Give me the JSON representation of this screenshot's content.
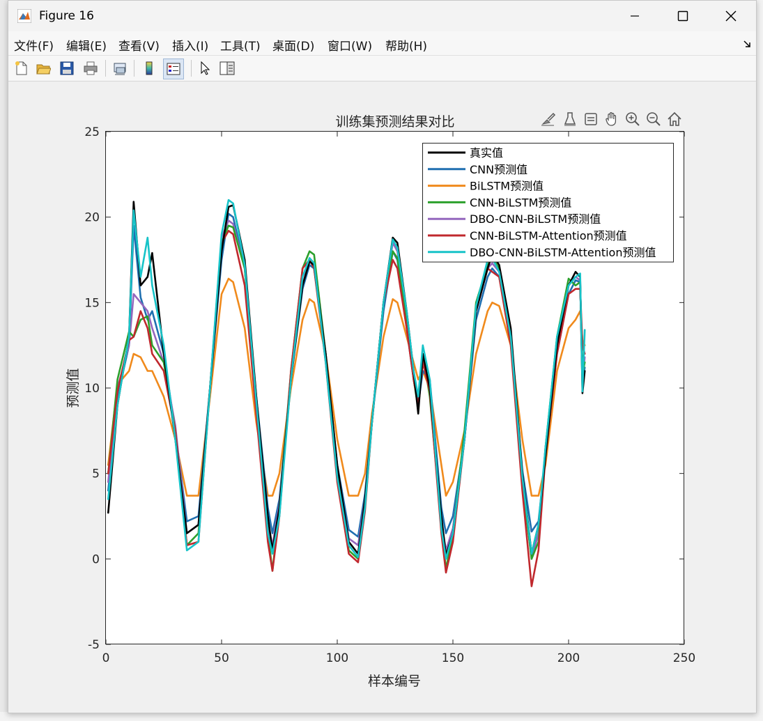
{
  "window": {
    "title": "Figure 16"
  },
  "menu": [
    {
      "label": "文件(F)"
    },
    {
      "label": "编辑(E)"
    },
    {
      "label": "查看(V)"
    },
    {
      "label": "插入(I)"
    },
    {
      "label": "工具(T)"
    },
    {
      "label": "桌面(D)"
    },
    {
      "label": "窗口(W)"
    },
    {
      "label": "帮助(H)"
    }
  ],
  "toolbar": {
    "icons": [
      "new-figure-icon",
      "open-file-icon",
      "save-icon",
      "print-icon",
      "link-plot-icon",
      "insert-colorbar-icon",
      "insert-legend-icon",
      "edit-plot-arrow-icon",
      "property-inspector-icon"
    ]
  },
  "axes_toolbar": {
    "icons": [
      "brush-icon",
      "data-tips-icon",
      "data-cursor-icon",
      "pan-icon",
      "zoom-in-icon",
      "zoom-out-icon",
      "home-icon"
    ]
  },
  "colors": {
    "真实值": "#000000",
    "CNN预测值": "#1f6fb0",
    "BiLSTM预测值": "#f08a1c",
    "CNN-BiLSTM预测值": "#2ca02c",
    "DBO-CNN-BiLSTM预测值": "#9467bd",
    "CNN-BiLSTM-Attention预测值": "#c0282d",
    "DBO-CNN-BiLSTM-Attention预测值": "#17c3c8"
  },
  "chart_data": {
    "type": "line",
    "title": "训练集预测结果对比",
    "xlabel": "样本编号",
    "ylabel": "预测值",
    "xlim": [
      0,
      250
    ],
    "ylim": [
      -5,
      25
    ],
    "xticks": [
      0,
      50,
      100,
      150,
      200,
      250
    ],
    "yticks": [
      -5,
      0,
      5,
      10,
      15,
      20,
      25
    ],
    "legend_position": "top-right",
    "x": [
      1,
      5,
      10,
      12,
      15,
      18,
      20,
      25,
      30,
      35,
      40,
      45,
      50,
      53,
      55,
      60,
      65,
      70,
      72,
      75,
      80,
      85,
      88,
      90,
      95,
      100,
      105,
      109,
      112,
      115,
      120,
      124,
      126,
      130,
      133,
      135,
      137,
      140,
      145,
      147,
      150,
      155,
      160,
      165,
      167,
      170,
      175,
      180,
      184,
      187,
      190,
      195,
      200,
      203,
      205,
      206,
      207
    ],
    "series": [
      {
        "name": "真实值",
        "values": [
          2.7,
          9.0,
          13.0,
          20.9,
          16.0,
          16.5,
          17.9,
          12.0,
          7.0,
          1.5,
          2.0,
          10.0,
          18.0,
          20.6,
          20.7,
          17.5,
          9.5,
          2.5,
          0.5,
          3.0,
          10.5,
          16.0,
          17.4,
          17.2,
          12.0,
          5.5,
          1.0,
          0.3,
          3.5,
          8.0,
          15.0,
          18.8,
          18.5,
          14.5,
          11.0,
          8.5,
          12.0,
          10.0,
          2.5,
          0.2,
          1.5,
          7.0,
          14.5,
          17.0,
          17.8,
          17.2,
          13.5,
          5.0,
          0.3,
          2.0,
          6.0,
          12.5,
          16.0,
          16.8,
          16.5,
          9.7,
          11.0
        ]
      },
      {
        "name": "CNN预测值",
        "values": [
          4.0,
          9.5,
          12.5,
          19.5,
          15.3,
          14.0,
          14.5,
          12.0,
          7.5,
          2.2,
          2.5,
          10.0,
          17.5,
          20.2,
          20.0,
          17.0,
          9.5,
          3.0,
          1.5,
          3.5,
          10.5,
          15.8,
          17.2,
          17.0,
          12.0,
          5.5,
          1.7,
          1.3,
          3.8,
          8.0,
          14.5,
          18.0,
          17.5,
          13.5,
          10.5,
          9.0,
          11.0,
          10.5,
          3.0,
          1.5,
          2.5,
          7.0,
          14.0,
          16.5,
          17.0,
          16.5,
          13.0,
          5.2,
          1.6,
          2.2,
          6.0,
          12.0,
          15.5,
          16.3,
          16.2,
          10.5,
          11.2
        ]
      },
      {
        "name": "BiLSTM预测值",
        "values": [
          5.5,
          10.2,
          11.0,
          12.0,
          11.8,
          11.0,
          11.0,
          9.5,
          7.0,
          3.7,
          3.7,
          9.5,
          15.5,
          16.4,
          16.2,
          13.5,
          8.0,
          3.7,
          3.7,
          5.0,
          10.0,
          14.0,
          15.2,
          15.0,
          12.0,
          7.0,
          3.7,
          3.7,
          5.0,
          8.5,
          13.0,
          15.2,
          15.0,
          13.0,
          11.5,
          10.5,
          11.0,
          10.0,
          5.5,
          3.7,
          4.5,
          7.5,
          12.0,
          14.5,
          15.0,
          14.8,
          12.5,
          7.0,
          3.7,
          3.7,
          5.5,
          11.0,
          13.5,
          14.0,
          14.5,
          12.8,
          12.5
        ]
      },
      {
        "name": "CNN-BiLSTM预测值",
        "values": [
          5.0,
          10.5,
          13.3,
          13.0,
          14.0,
          14.2,
          12.5,
          11.5,
          7.5,
          0.8,
          1.5,
          10.0,
          18.5,
          19.5,
          19.4,
          17.0,
          9.0,
          1.5,
          -0.7,
          3.0,
          11.0,
          17.0,
          18.0,
          17.8,
          12.0,
          5.0,
          0.5,
          0.0,
          3.0,
          8.0,
          15.0,
          18.0,
          17.6,
          14.0,
          10.5,
          8.8,
          12.0,
          9.5,
          2.0,
          -0.6,
          1.5,
          7.5,
          15.0,
          17.2,
          17.6,
          17.0,
          12.8,
          4.5,
          0.0,
          1.0,
          6.5,
          13.0,
          16.4,
          16.0,
          16.2,
          10.8,
          11.5
        ]
      },
      {
        "name": "DBO-CNN-BiLSTM预测值",
        "values": [
          4.5,
          10.0,
          12.5,
          15.5,
          15.0,
          14.5,
          13.5,
          11.5,
          7.8,
          1.5,
          2.0,
          10.0,
          18.8,
          19.8,
          19.6,
          17.0,
          9.2,
          2.0,
          0.8,
          3.2,
          10.8,
          16.0,
          17.6,
          17.3,
          12.0,
          5.0,
          1.2,
          0.8,
          3.5,
          8.0,
          15.0,
          18.5,
          18.0,
          14.0,
          11.0,
          9.2,
          11.5,
          10.0,
          2.2,
          0.5,
          1.8,
          7.0,
          14.5,
          17.0,
          17.3,
          16.8,
          12.8,
          4.5,
          0.0,
          1.5,
          6.5,
          12.5,
          16.0,
          16.5,
          16.3,
          10.5,
          11.8
        ]
      },
      {
        "name": "CNN-BiLSTM-Attention预测值",
        "values": [
          5.0,
          9.8,
          12.8,
          13.0,
          14.5,
          13.5,
          12.0,
          11.0,
          7.5,
          0.8,
          1.0,
          10.0,
          18.5,
          19.2,
          19.0,
          16.0,
          8.5,
          1.0,
          -0.7,
          2.5,
          11.0,
          17.0,
          17.5,
          17.0,
          11.5,
          4.5,
          0.3,
          -0.2,
          2.8,
          8.0,
          15.0,
          17.5,
          17.0,
          13.5,
          10.5,
          9.0,
          11.5,
          9.8,
          1.5,
          -0.8,
          1.0,
          7.0,
          14.5,
          17.0,
          16.8,
          16.5,
          12.5,
          4.0,
          -1.6,
          0.5,
          6.0,
          12.0,
          15.5,
          15.8,
          15.8,
          12.5,
          12.0
        ]
      },
      {
        "name": "DBO-CNN-BiLSTM-Attention预测值",
        "values": [
          3.5,
          9.0,
          13.0,
          20.4,
          16.5,
          18.8,
          16.0,
          12.5,
          7.0,
          0.5,
          1.0,
          10.0,
          19.0,
          21.0,
          20.8,
          17.2,
          9.2,
          1.5,
          0.3,
          2.5,
          10.5,
          16.5,
          17.6,
          17.3,
          11.5,
          4.8,
          0.8,
          0.1,
          3.0,
          8.0,
          15.0,
          18.7,
          18.2,
          14.5,
          11.0,
          9.5,
          12.5,
          10.5,
          1.8,
          0.0,
          1.5,
          7.0,
          14.8,
          17.5,
          17.6,
          16.8,
          13.0,
          4.8,
          0.3,
          2.0,
          6.5,
          13.0,
          16.0,
          16.5,
          16.7,
          9.8,
          13.4
        ]
      }
    ]
  }
}
